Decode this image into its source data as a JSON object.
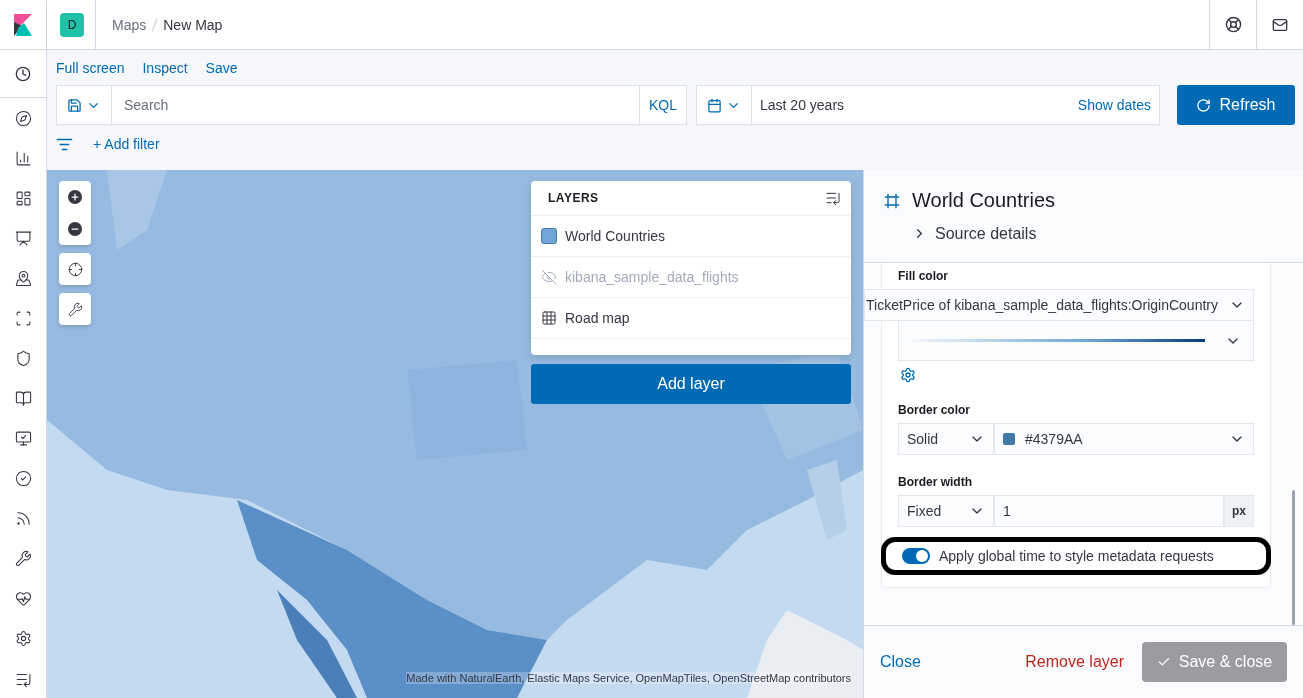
{
  "header": {
    "avatar": "D",
    "breadcrumbs": [
      "Maps",
      "New Map"
    ]
  },
  "top_nav": [
    "Full screen",
    "Inspect",
    "Save"
  ],
  "query_bar": {
    "placeholder": "Search",
    "language": "KQL",
    "time_range": "Last 20 years",
    "show_dates": "Show dates",
    "refresh": "Refresh"
  },
  "filter_bar": {
    "add_filter": "+ Add filter"
  },
  "layers_panel": {
    "title": "LAYERS",
    "layers": [
      {
        "name": "World Countries",
        "kind": "vector",
        "visible": true
      },
      {
        "name": "kibana_sample_data_flights",
        "kind": "vector",
        "visible": false
      },
      {
        "name": "Road map",
        "kind": "tile",
        "visible": true
      }
    ],
    "add_layer": "Add layer"
  },
  "attribution": "Made with NaturalEarth, Elastic Maps Service, OpenMapTiles, OpenStreetMap contributors",
  "editor": {
    "title": "World Countries",
    "source_details": "Source details",
    "source_expanded": false,
    "fill_color": {
      "label": "Fill color",
      "field": "TicketPrice of kibana_sample_data_flights:OriginCountry"
    },
    "border_color": {
      "label": "Border color",
      "mode": "Solid",
      "value": "#4379AA"
    },
    "border_width": {
      "label": "Border width",
      "mode": "Fixed",
      "value": "1",
      "unit": "px"
    },
    "global_time": {
      "label": "Apply global time to style metadata requests",
      "on": true,
      "highlighted": true
    },
    "footer": {
      "close": "Close",
      "remove": "Remove layer",
      "save": "Save & close",
      "save_disabled": true
    }
  }
}
